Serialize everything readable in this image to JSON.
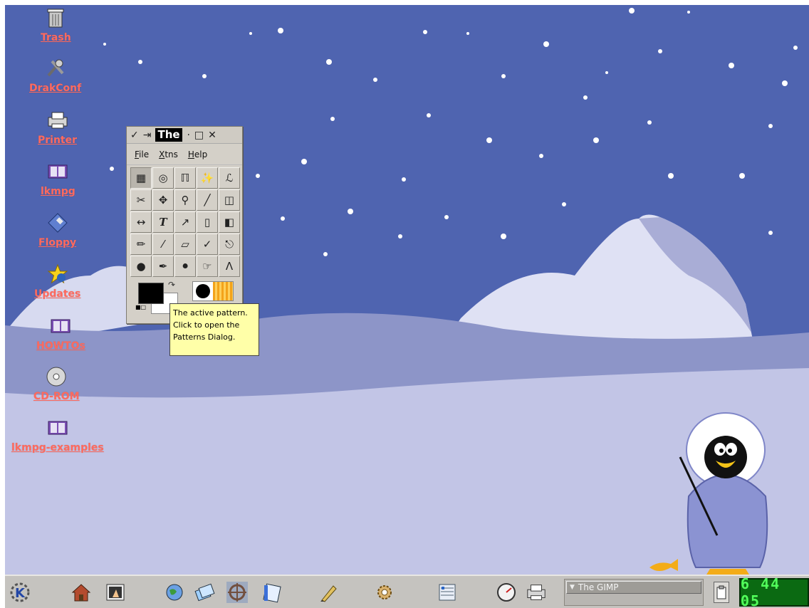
{
  "colors": {
    "sky": "#4f64b0",
    "snow": "#c2c5e6",
    "icon_label": "#ff6a5e",
    "clock_digits": "#52ff5b",
    "clock_bg": "#0b6a12",
    "tooltip_bg": "#ffffa8"
  },
  "desktop_icons": [
    {
      "label": "Trash",
      "icon": "trash-icon"
    },
    {
      "label": "DrakConf",
      "icon": "tools-icon"
    },
    {
      "label": "Printer",
      "icon": "printer-icon"
    },
    {
      "label": "lkmpg",
      "icon": "book-icon"
    },
    {
      "label": "Floppy",
      "icon": "floppy-icon"
    },
    {
      "label": "Updates",
      "icon": "star-icon"
    },
    {
      "label": "HOWTOs",
      "icon": "book-icon"
    },
    {
      "label": "CD-ROM",
      "icon": "cdrom-icon"
    },
    {
      "label": "lkmpg-examples",
      "icon": "book-icon"
    }
  ],
  "gimp": {
    "title": "The",
    "menu": {
      "file": "File",
      "xtns": "Xtns",
      "help": "Help"
    },
    "tools": [
      "rect-select-icon",
      "ellipse-select-icon",
      "free-select-icon",
      "fuzzy-select-icon",
      "bezier-select-icon",
      "scissors-icon",
      "move-icon",
      "magnify-icon",
      "crop-icon",
      "transform-icon",
      "flip-icon",
      "text-icon",
      "color-picker-icon",
      "bucket-fill-icon",
      "blend-icon",
      "pencil-icon",
      "paintbrush-icon",
      "eraser-icon",
      "airbrush-icon",
      "clone-icon",
      "convolve-icon",
      "ink-icon",
      "dodge-burn-icon",
      "smudge-icon",
      "measure-icon"
    ],
    "tooltip": {
      "line1": "The active pattern.",
      "line2": "Click to open the",
      "line3": "Patterns Dialog."
    }
  },
  "taskbar": {
    "launchers": [
      "k-menu-icon",
      "home-icon",
      "desktop-icon",
      "globe-icon",
      "window-list-icon",
      "konqueror-icon",
      "notes-icon",
      "editor-icon",
      "settings-icon",
      "kpackage-icon",
      "system-monitor-icon",
      "printer-icon"
    ],
    "task": "The GIMP",
    "clock": "6 44 05"
  }
}
